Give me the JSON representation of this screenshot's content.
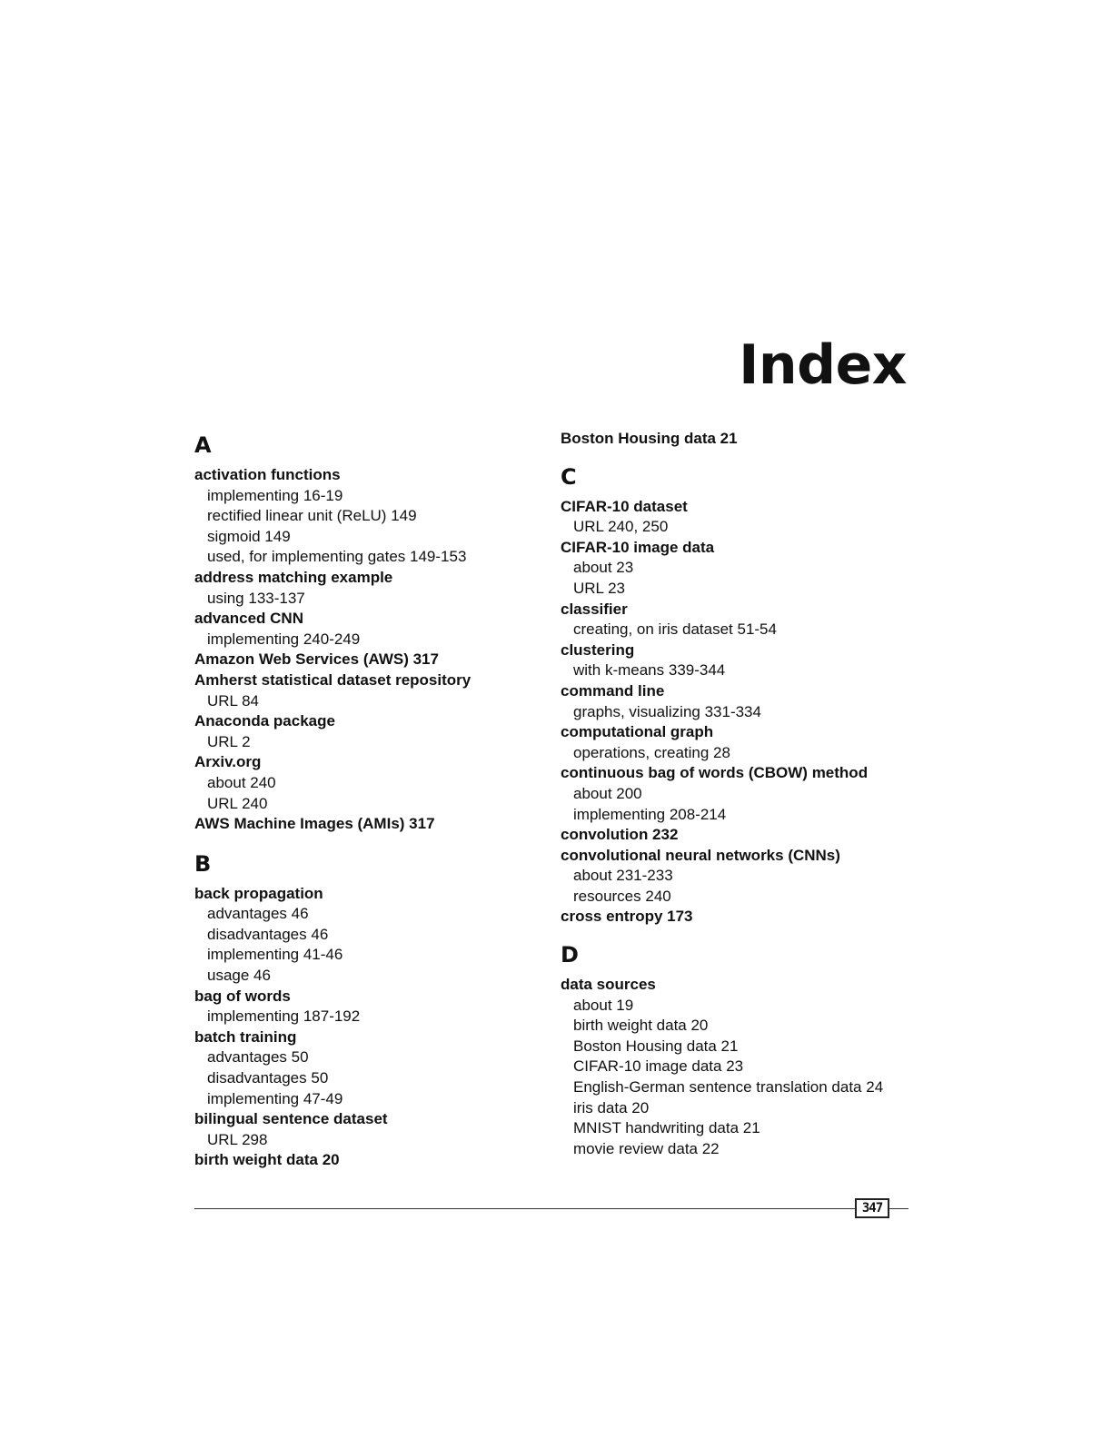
{
  "page": {
    "title": "Index",
    "page_number": "347"
  },
  "left_column": {
    "sections": [
      {
        "letter": "A",
        "entries": [
          {
            "text": "activation functions",
            "level": "main"
          },
          {
            "text": "implementing  16-19",
            "level": "sub"
          },
          {
            "text": "rectified linear unit (ReLU)  149",
            "level": "sub"
          },
          {
            "text": "sigmoid  149",
            "level": "sub"
          },
          {
            "text": "used, for implementing gates  149-153",
            "level": "sub"
          },
          {
            "text": "address matching example",
            "level": "main"
          },
          {
            "text": "using  133-137",
            "level": "sub"
          },
          {
            "text": "advanced CNN",
            "level": "main"
          },
          {
            "text": "implementing  240-249",
            "level": "sub"
          },
          {
            "text": "Amazon Web Services (AWS)  317",
            "level": "main"
          },
          {
            "text": "Amherst statistical dataset repository",
            "level": "main"
          },
          {
            "text": "URL  84",
            "level": "sub"
          },
          {
            "text": "Anaconda package",
            "level": "main"
          },
          {
            "text": "URL  2",
            "level": "sub"
          },
          {
            "text": "Arxiv.org",
            "level": "main"
          },
          {
            "text": "about  240",
            "level": "sub"
          },
          {
            "text": "URL  240",
            "level": "sub"
          },
          {
            "text": "AWS Machine Images (AMIs)  317",
            "level": "main"
          }
        ]
      },
      {
        "letter": "B",
        "entries": [
          {
            "text": "back propagation",
            "level": "main"
          },
          {
            "text": "advantages  46",
            "level": "sub"
          },
          {
            "text": "disadvantages  46",
            "level": "sub"
          },
          {
            "text": "implementing  41-46",
            "level": "sub"
          },
          {
            "text": "usage  46",
            "level": "sub"
          },
          {
            "text": "bag of words",
            "level": "main"
          },
          {
            "text": "implementing  187-192",
            "level": "sub"
          },
          {
            "text": "batch training",
            "level": "main"
          },
          {
            "text": "advantages  50",
            "level": "sub"
          },
          {
            "text": "disadvantages  50",
            "level": "sub"
          },
          {
            "text": "implementing  47-49",
            "level": "sub"
          },
          {
            "text": "bilingual sentence dataset",
            "level": "main"
          },
          {
            "text": "URL  298",
            "level": "sub"
          },
          {
            "text": "birth weight data  20",
            "level": "main"
          }
        ]
      }
    ]
  },
  "right_column": {
    "continued_entries": [
      {
        "text": "Boston Housing data  21",
        "level": "main"
      }
    ],
    "sections": [
      {
        "letter": "C",
        "entries": [
          {
            "text": "CIFAR-10 dataset",
            "level": "main"
          },
          {
            "text": "URL  240, 250",
            "level": "sub"
          },
          {
            "text": "CIFAR-10 image data",
            "level": "main"
          },
          {
            "text": "about  23",
            "level": "sub"
          },
          {
            "text": "URL  23",
            "level": "sub"
          },
          {
            "text": "classifier",
            "level": "main"
          },
          {
            "text": "creating, on iris dataset  51-54",
            "level": "sub"
          },
          {
            "text": "clustering",
            "level": "main"
          },
          {
            "text": "with k-means  339-344",
            "level": "sub"
          },
          {
            "text": "command line",
            "level": "main"
          },
          {
            "text": "graphs, visualizing  331-334",
            "level": "sub"
          },
          {
            "text": "computational graph",
            "level": "main"
          },
          {
            "text": "operations, creating  28",
            "level": "sub"
          },
          {
            "text": "continuous bag of words (CBOW) method",
            "level": "main"
          },
          {
            "text": "about  200",
            "level": "sub"
          },
          {
            "text": "implementing  208-214",
            "level": "sub"
          },
          {
            "text": "convolution  232",
            "level": "main"
          },
          {
            "text": "convolutional neural networks (CNNs)",
            "level": "main"
          },
          {
            "text": "about  231-233",
            "level": "sub"
          },
          {
            "text": "resources  240",
            "level": "sub"
          },
          {
            "text": "cross entropy  173",
            "level": "main"
          }
        ]
      },
      {
        "letter": "D",
        "entries": [
          {
            "text": "data sources",
            "level": "main"
          },
          {
            "text": "about  19",
            "level": "sub"
          },
          {
            "text": "birth weight data  20",
            "level": "sub"
          },
          {
            "text": "Boston Housing data  21",
            "level": "sub"
          },
          {
            "text": "CIFAR-10 image data  23",
            "level": "sub"
          },
          {
            "text": "English-German sentence translation data  24",
            "level": "sub"
          },
          {
            "text": "iris data  20",
            "level": "sub"
          },
          {
            "text": "MNIST handwriting data  21",
            "level": "sub"
          },
          {
            "text": "movie review data  22",
            "level": "sub"
          }
        ]
      }
    ]
  }
}
